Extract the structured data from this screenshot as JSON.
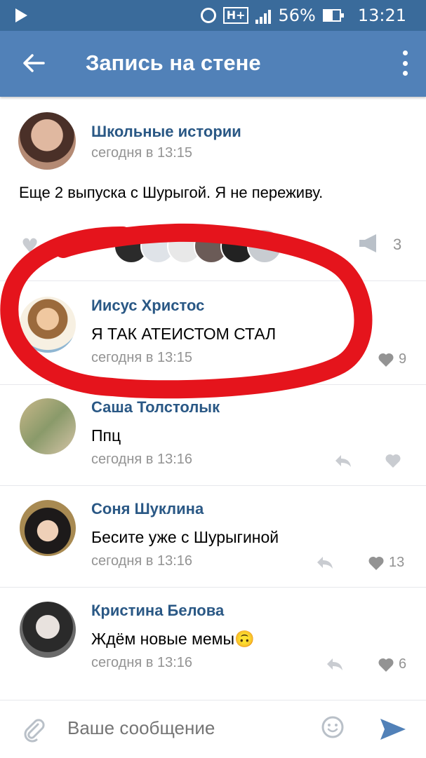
{
  "status_bar": {
    "battery": "56%",
    "time": "13:21",
    "network": "H+"
  },
  "header": {
    "title": "Запись на стене"
  },
  "post": {
    "author": "Школьные истории",
    "time": "сегодня в 13:15",
    "text": "Еще 2 выпуска с Шурыгой. Я не переживу.",
    "shares": "3"
  },
  "comments": [
    {
      "author": "Иисус Христос",
      "text": "Я ТАК АТЕИСТОМ СТАЛ",
      "time": "сегодня в 13:15",
      "likes": "9"
    },
    {
      "author": "Саша Толстолык",
      "text": "Ппц",
      "time": "сегодня в 13:16",
      "likes": ""
    },
    {
      "author": "Соня Шуклина",
      "text": "Бесите уже с Шурыгиной",
      "time": "сегодня в 13:16",
      "likes": "13"
    },
    {
      "author": "Кристина Белова",
      "text": "Ждём новые мемы🙃",
      "time": "сегодня в 13:16",
      "likes": "6"
    }
  ],
  "composer": {
    "placeholder": "Ваше сообщение"
  },
  "colors": {
    "header": "#5181b8",
    "status_bar": "#3a6b9b",
    "link": "#2a5885",
    "meta": "#939393",
    "annotation": "#e5141c"
  }
}
